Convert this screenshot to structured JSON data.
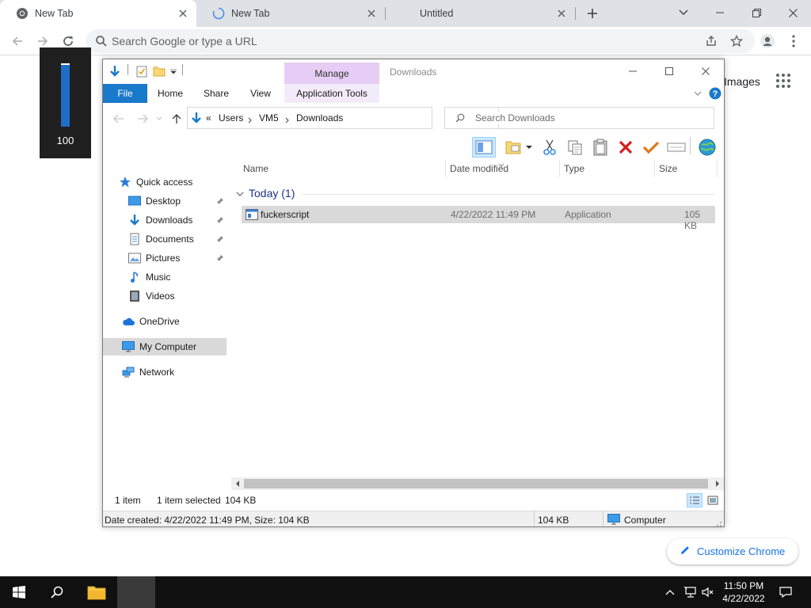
{
  "chrome": {
    "tabs": [
      {
        "title": "New Tab",
        "favicon": "chrome-logo-icon"
      },
      {
        "title": "New Tab",
        "favicon": "loading-spinner-icon"
      },
      {
        "title": "Untitled",
        "favicon": ""
      }
    ],
    "omnibox_placeholder": "Search Google or type a URL",
    "images_link": "Images",
    "customize_label": "Customize Chrome"
  },
  "volume": {
    "value_label": "100",
    "level_percent": 100
  },
  "explorer": {
    "title": "Downloads",
    "manage_tab": "Manage",
    "ribbon_tabs": [
      "File",
      "Home",
      "Share",
      "View",
      "Application Tools"
    ],
    "breadcrumb_prefix": "«",
    "breadcrumb": [
      "Users",
      "VM5",
      "Downloads"
    ],
    "search_placeholder": "Search Downloads",
    "nav": {
      "quick_access": "Quick access",
      "items": [
        "Desktop",
        "Downloads",
        "Documents",
        "Pictures",
        "Music",
        "Videos"
      ],
      "onedrive": "OneDrive",
      "my_computer": "My Computer",
      "network": "Network"
    },
    "columns": [
      "Name",
      "Date modified",
      "Type",
      "Size"
    ],
    "group_label": "Today (1)",
    "files": [
      {
        "name": "fuckerscript",
        "date_modified": "4/22/2022 11:49 PM",
        "type": "Application",
        "size": "105 KB"
      }
    ],
    "status": {
      "item_count": "1 item",
      "selected": "1 item selected",
      "selected_size": "104 KB"
    },
    "details_bar": {
      "info": "Date created: 4/22/2022 11:49 PM, Size: 104 KB",
      "size": "104 KB",
      "location": "Computer"
    }
  },
  "taskbar": {
    "time": "11:50 PM",
    "date": "4/22/2022"
  },
  "colors": {
    "accent": "#1979ca",
    "manage_tab": "#e6cdf5",
    "delete_red": "#d81e1e",
    "chrome_link": "#1a73e8"
  }
}
